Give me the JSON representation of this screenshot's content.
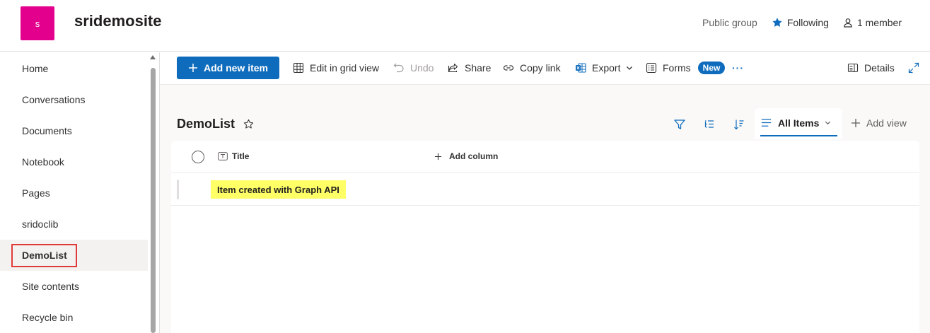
{
  "site": {
    "logo_letter": "s",
    "title": "sridemosite",
    "group_type": "Public group",
    "following_label": "Following",
    "members_label": "1 member"
  },
  "nav": {
    "items": [
      {
        "label": "Home"
      },
      {
        "label": "Conversations"
      },
      {
        "label": "Documents"
      },
      {
        "label": "Notebook"
      },
      {
        "label": "Pages"
      },
      {
        "label": "sridoclib"
      },
      {
        "label": "DemoList"
      },
      {
        "label": "Site contents"
      },
      {
        "label": "Recycle bin"
      }
    ],
    "selected": "DemoList"
  },
  "toolbar": {
    "add_new_item": "Add new item",
    "edit_grid": "Edit in grid view",
    "undo": "Undo",
    "share": "Share",
    "copy_link": "Copy link",
    "export": "Export",
    "forms": "Forms",
    "forms_badge": "New",
    "more": "···",
    "details": "Details"
  },
  "list": {
    "title": "DemoList",
    "view_name": "All Items",
    "add_view": "Add view",
    "columns": {
      "title": "Title",
      "add_column": "Add column"
    },
    "rows": [
      {
        "title": "Item created with Graph API"
      }
    ]
  },
  "colors": {
    "accent": "#0f6cbd",
    "site_logo": "#e3008c",
    "highlight": "#ffff66",
    "annotation_box": "#e03b3b"
  }
}
